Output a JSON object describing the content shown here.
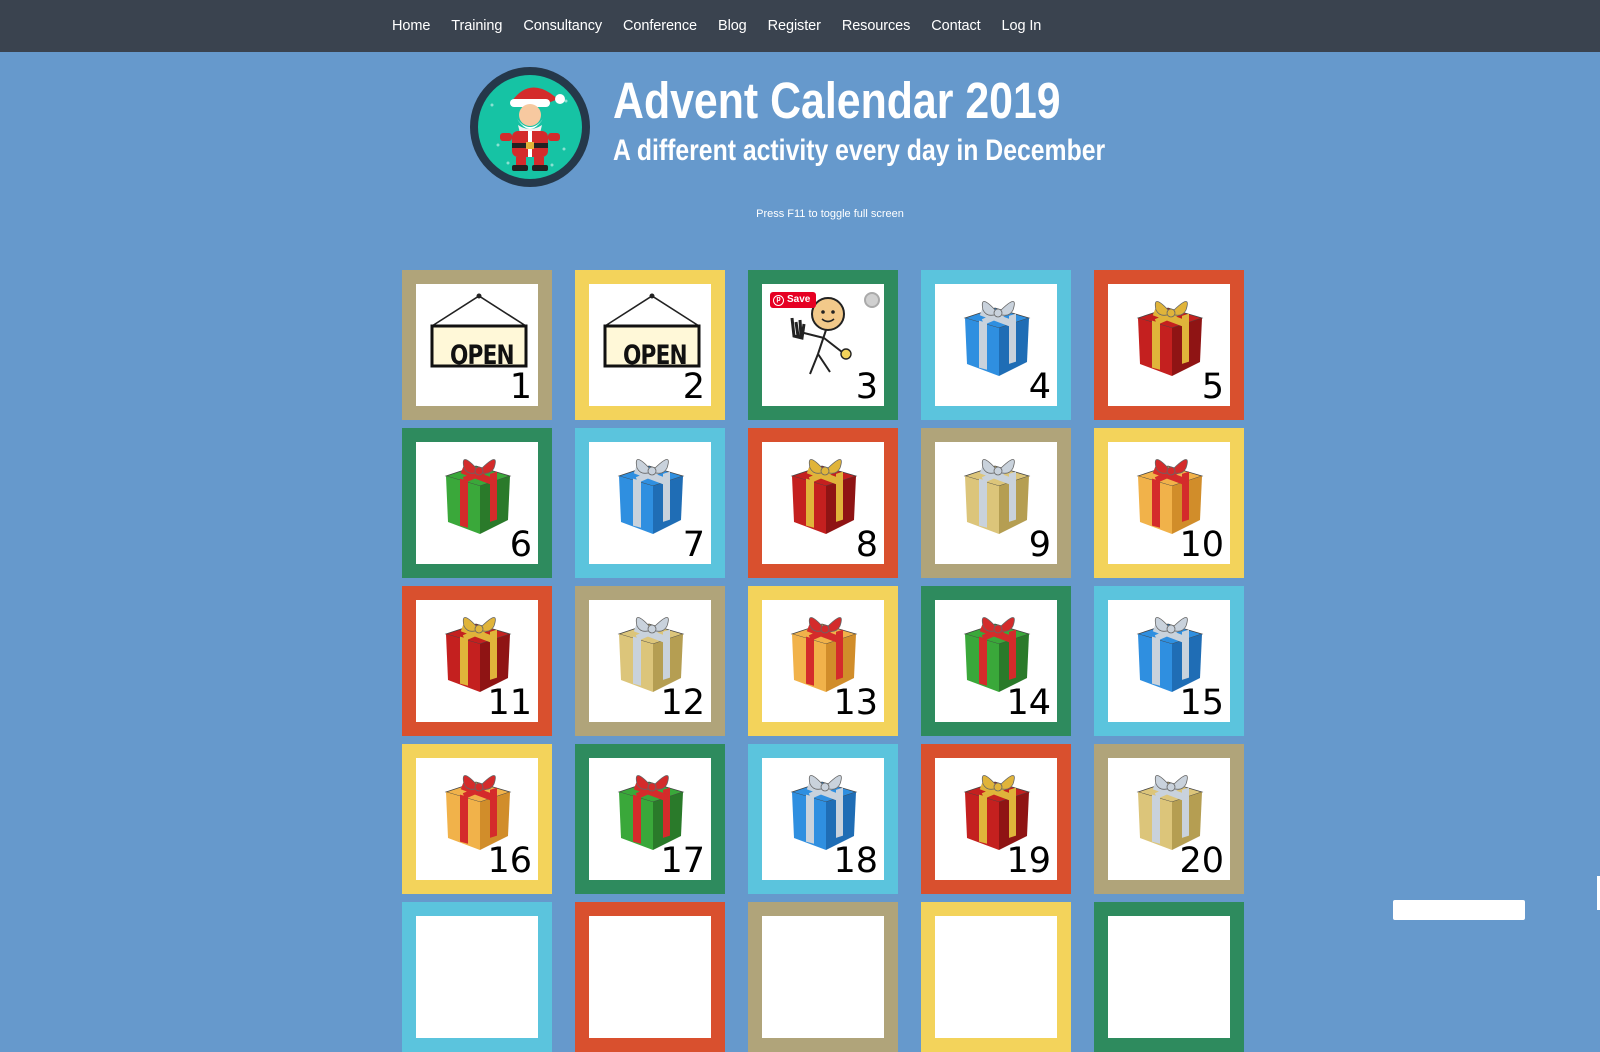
{
  "nav": {
    "items": [
      "Home",
      "Training",
      "Consultancy",
      "Conference",
      "Blog",
      "Register",
      "Resources",
      "Contact",
      "Log In"
    ]
  },
  "header": {
    "logo_icon": "santa-icon",
    "title": "Advent Calendar 2019",
    "subtitle": "A different activity every day in December"
  },
  "hint": "Press F11 to toggle full screen",
  "save_badge": "Save",
  "colors": {
    "background": "#6699cc",
    "navbar": "#3a434f",
    "frame_tan": "#b0a47a",
    "frame_yellow": "#f3d35b",
    "frame_green": "#2e8b5e",
    "frame_cyan": "#5bc4dd",
    "frame_red": "#d9502e"
  },
  "tiles": [
    {
      "day": "1",
      "frame": "tan",
      "art": "open-sign"
    },
    {
      "day": "2",
      "frame": "yellow",
      "art": "open-sign"
    },
    {
      "day": "3",
      "frame": "green",
      "art": "stick-figure-waving"
    },
    {
      "day": "4",
      "frame": "cyan",
      "art": "gift-blue"
    },
    {
      "day": "5",
      "frame": "red",
      "art": "gift-red"
    },
    {
      "day": "6",
      "frame": "green",
      "art": "gift-green"
    },
    {
      "day": "7",
      "frame": "cyan",
      "art": "gift-blue"
    },
    {
      "day": "8",
      "frame": "red",
      "art": "gift-red"
    },
    {
      "day": "9",
      "frame": "tan",
      "art": "gift-gold"
    },
    {
      "day": "10",
      "frame": "yellow",
      "art": "gift-orange"
    },
    {
      "day": "11",
      "frame": "red",
      "art": "gift-red"
    },
    {
      "day": "12",
      "frame": "tan",
      "art": "gift-gold"
    },
    {
      "day": "13",
      "frame": "yellow",
      "art": "gift-orange"
    },
    {
      "day": "14",
      "frame": "green",
      "art": "gift-green"
    },
    {
      "day": "15",
      "frame": "cyan",
      "art": "gift-blue"
    },
    {
      "day": "16",
      "frame": "yellow",
      "art": "gift-orange"
    },
    {
      "day": "17",
      "frame": "green",
      "art": "gift-green"
    },
    {
      "day": "18",
      "frame": "cyan",
      "art": "gift-blue"
    },
    {
      "day": "19",
      "frame": "red",
      "art": "gift-red"
    },
    {
      "day": "20",
      "frame": "tan",
      "art": "gift-gold"
    },
    {
      "day": "",
      "frame": "cyan",
      "art": "none"
    },
    {
      "day": "",
      "frame": "red",
      "art": "none"
    },
    {
      "day": "",
      "frame": "tan",
      "art": "none"
    },
    {
      "day": "",
      "frame": "yellow",
      "art": "none"
    },
    {
      "day": "",
      "frame": "green",
      "art": "none"
    }
  ],
  "open_sign_text": "OPEN"
}
